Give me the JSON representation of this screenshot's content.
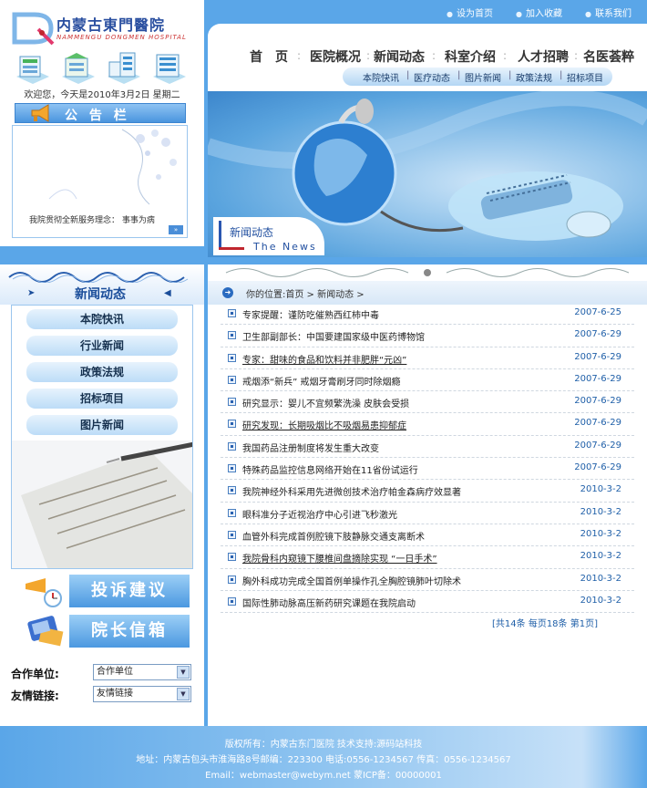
{
  "hospital": {
    "name_cn": "内蒙古東門醫院",
    "name_en": "NAMMENGU DONGMEN HOSPITAL"
  },
  "welcome": "欢迎您，今天是2010年3月2日 星期二",
  "notice": {
    "title": "公 告 栏",
    "message": "我院贯彻全新服务理念：  事事为病",
    "more_label": "»"
  },
  "left_nav": {
    "title": "新闻动态",
    "items": [
      "本院快讯",
      "行业新闻",
      "政策法规",
      "招标项目",
      "图片新闻"
    ]
  },
  "big_buttons": {
    "complaint": "投诉建议",
    "mailbox": "院长信箱"
  },
  "selects": {
    "partner_label": "合作单位:",
    "partner_value": "合作单位",
    "links_label": "友情链接:",
    "links_value": "友情链接"
  },
  "top_links": [
    "设为首页",
    "加入收藏",
    "联系我们"
  ],
  "main_nav": [
    "首　页",
    "医院概况",
    "新闻动态",
    "科室介绍",
    "人才招聘",
    "名医荟粹"
  ],
  "sub_nav": [
    "本院快讯",
    "医疗动态",
    "图片新闻",
    "政策法规",
    "招标项目"
  ],
  "banner": {
    "tag_cn": "新闻动态",
    "tag_en": "The News"
  },
  "breadcrumb": "你的位置:首页 > 新闻动态 >",
  "news": [
    {
      "title": "专家提醒：谨防吃催熟西红柿中毒",
      "date": "2007-6-25",
      "underline": false
    },
    {
      "title": "卫生部副部长：中国要建国家级中医药博物馆",
      "date": "2007-6-29",
      "underline": false
    },
    {
      "title": "专家：甜味的食品和饮料并非肥胖“元凶”",
      "date": "2007-6-29",
      "underline": true
    },
    {
      "title": "戒烟添“新兵”  戒烟牙膏刷牙同时除烟瘾",
      "date": "2007-6-29",
      "underline": false
    },
    {
      "title": "研究显示：婴儿不宜频繁洗澡 皮肤会受损",
      "date": "2007-6-29",
      "underline": false
    },
    {
      "title": "研究发现：长期吸烟比不吸烟易患抑郁症",
      "date": "2007-6-29",
      "underline": true
    },
    {
      "title": "我国药品注册制度将发生重大改变",
      "date": "2007-6-29",
      "underline": false
    },
    {
      "title": "特殊药品监控信息网络开始在11省份试运行",
      "date": "2007-6-29",
      "underline": false
    },
    {
      "title": "我院神经外科采用先进微创技术治疗帕金森病疗效显著",
      "date": "2010-3-2",
      "underline": false
    },
    {
      "title": "眼科准分子近视治疗中心引进飞秒激光",
      "date": "2010-3-2",
      "underline": false
    },
    {
      "title": "血管外科完成首例腔镜下肢静脉交通支离断术",
      "date": "2010-3-2",
      "underline": false
    },
    {
      "title": "我院骨科内窥镜下腰椎间盘摘除实现 “一日手术”",
      "date": "2010-3-2",
      "underline": true
    },
    {
      "title": "胸外科成功完成全国首例单操作孔全胸腔镜肺叶切除术",
      "date": "2010-3-2",
      "underline": false
    },
    {
      "title": "国际性肺动脉高压新药研究课题在我院启动",
      "date": "2010-3-2",
      "underline": false
    }
  ],
  "pager": "[共14条  每页18条  第1页]",
  "footer": {
    "line1": "版权所有：内蒙古东门医院  技术支持:源码站科技",
    "line2": "地址：内蒙古包头市淮海路8号邮编：223300  电话:0556-1234567  传真：0556-1234567",
    "line3": "Email：webmaster@webym.net  蒙ICP备：00000001"
  },
  "colors": {
    "page_bg": "#5aa6e8",
    "accent": "#1f5fa8",
    "panel_border": "#9bc6ee"
  }
}
